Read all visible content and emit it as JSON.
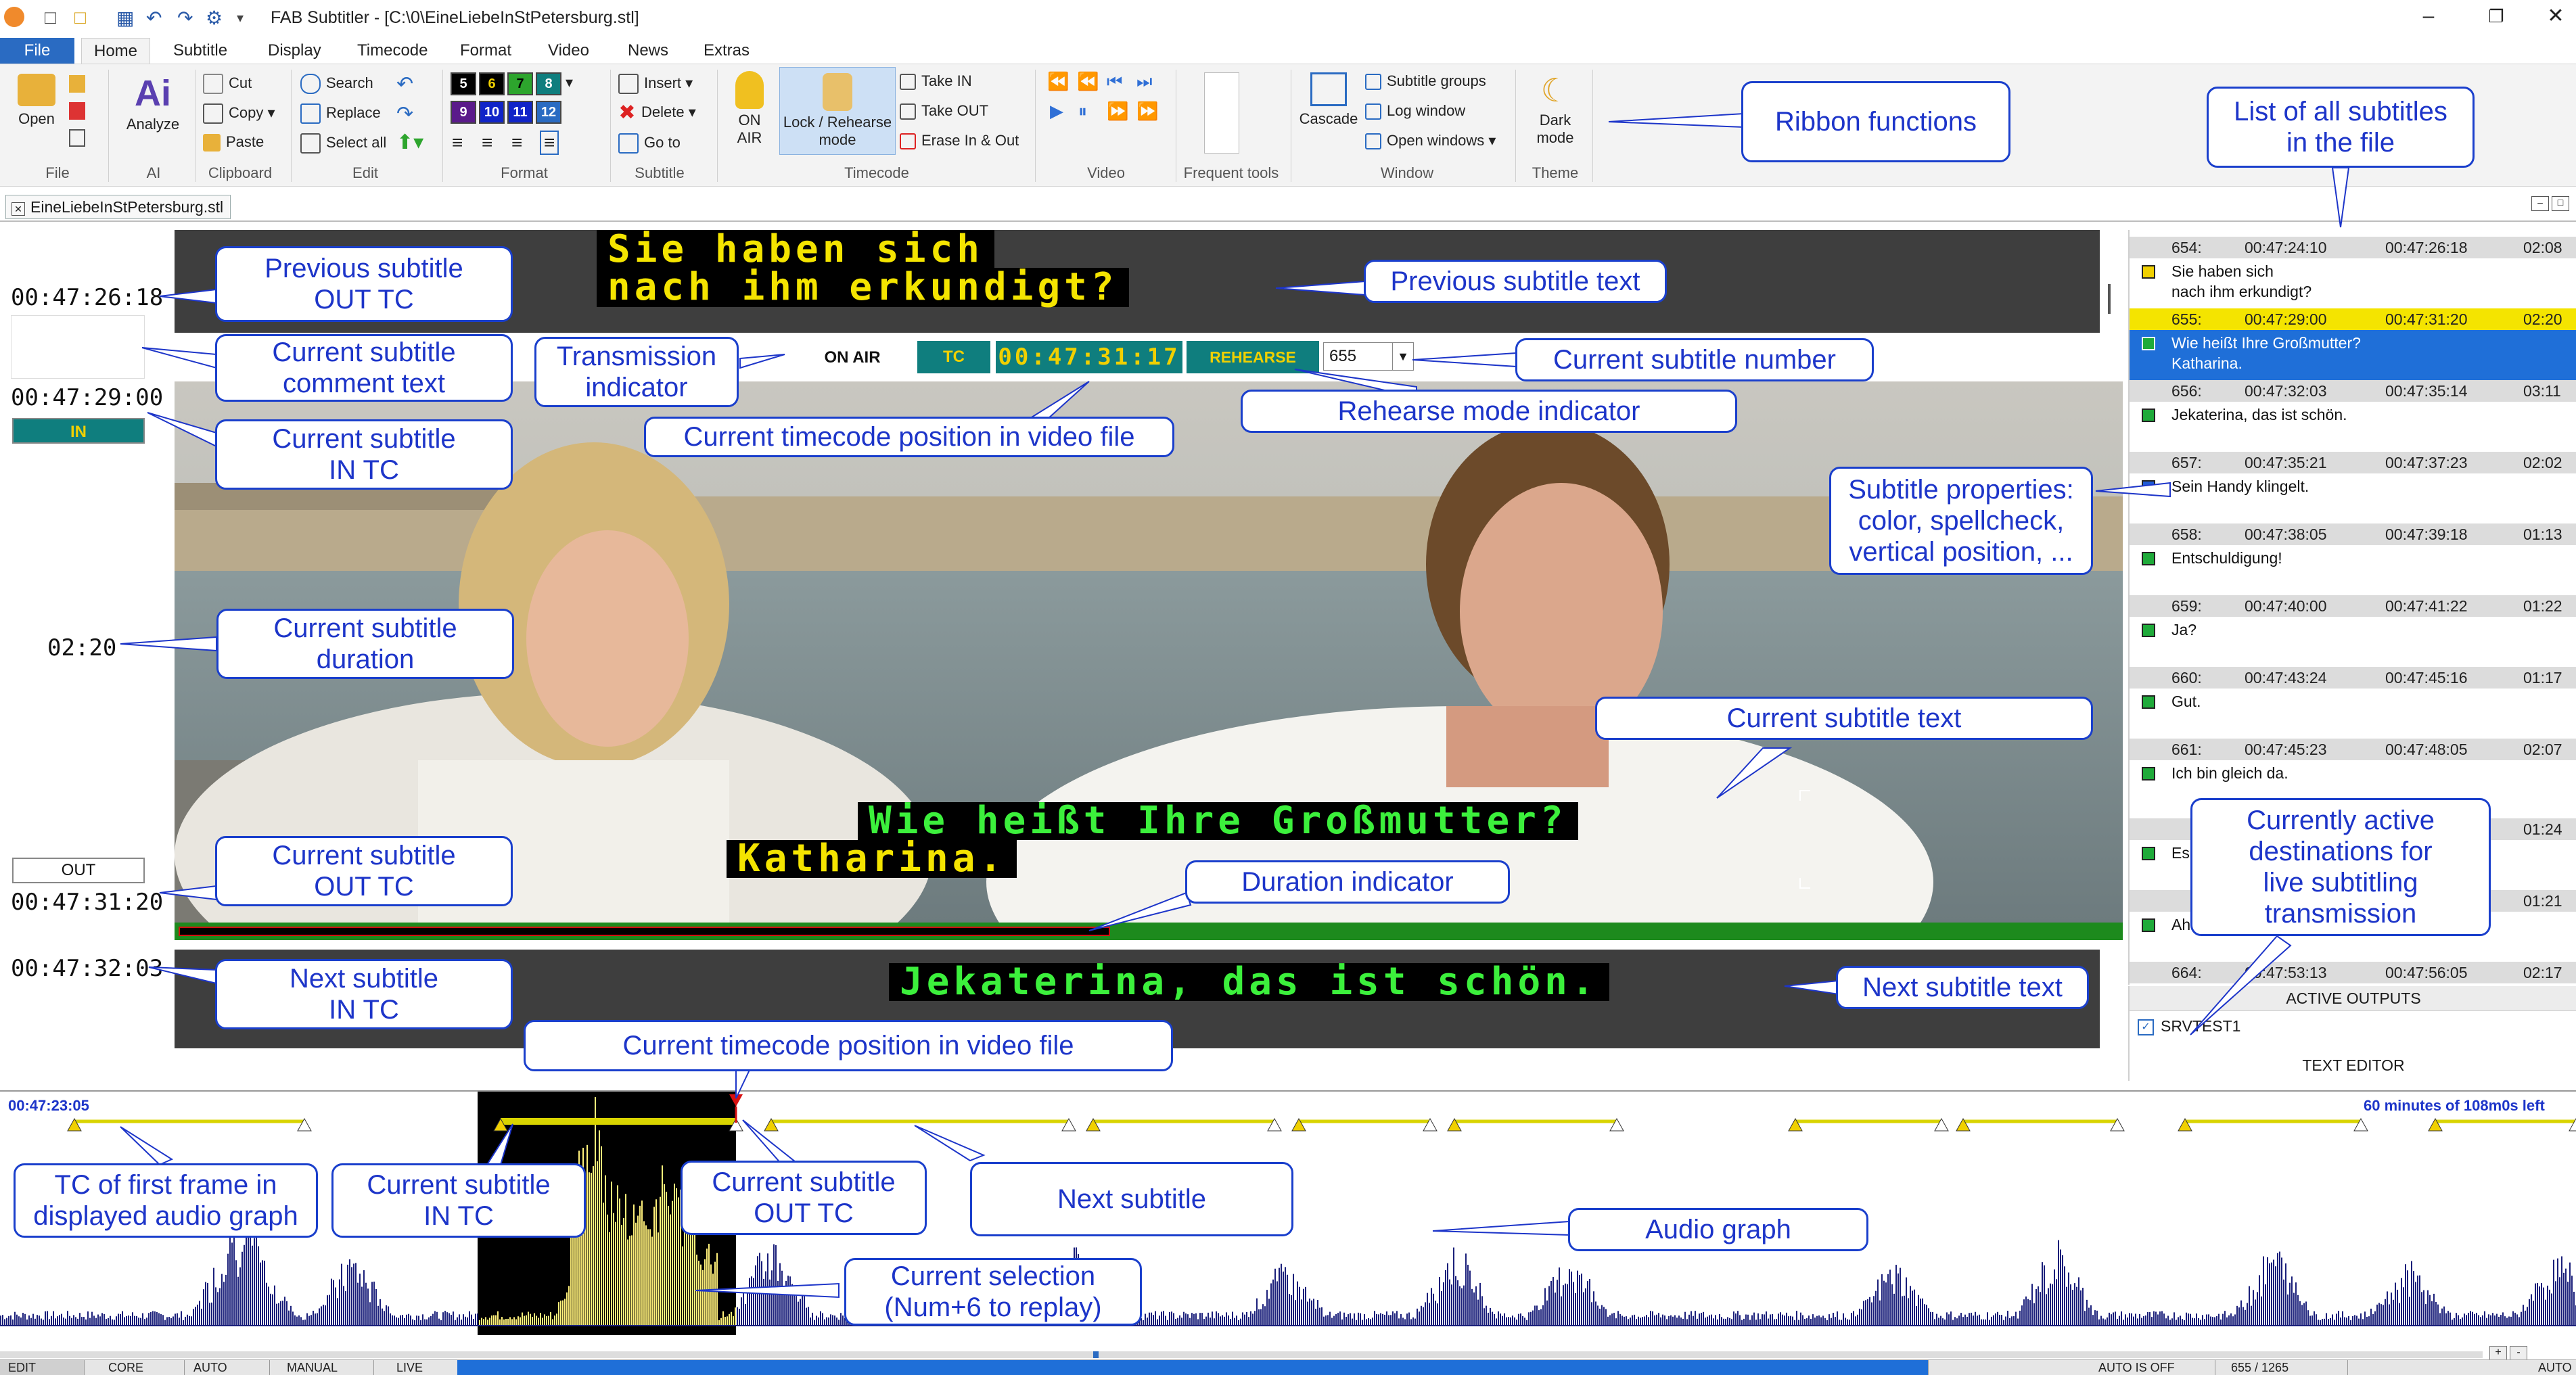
{
  "window": {
    "title": "FAB Subtitler - [C:\\0\\EineLiebeInStPetersburg.stl]",
    "doc_tab": "EineLiebeInStPetersburg.stl"
  },
  "tabs": [
    "File",
    "Home",
    "Subtitle",
    "Display",
    "Timecode",
    "Format",
    "Video",
    "News",
    "Extras"
  ],
  "ribbon": {
    "groups": {
      "file": "File",
      "ai": "AI",
      "clipboard": "Clipboard",
      "edit": "Edit",
      "format": "Format",
      "subtitle": "Subtitle",
      "timecode": "Timecode",
      "video": "Video",
      "frequent": "Frequent tools",
      "window": "Window",
      "theme": "Theme"
    },
    "open": "Open",
    "analyze": "Analyze",
    "cut": "Cut",
    "copy": "Copy",
    "paste": "Paste",
    "search": "Search",
    "replace": "Replace",
    "select_all": "Select all",
    "color_codes": [
      "5",
      "6",
      "7",
      "8",
      "9",
      "10",
      "11",
      "12"
    ],
    "insert": "Insert",
    "delete": "Delete",
    "goto": "Go to",
    "on_air_1": "ON",
    "on_air_2": "AIR",
    "lock_1": "Lock / Rehearse",
    "lock_2": "mode",
    "take_in": "Take IN",
    "take_out": "Take OUT",
    "erase": "Erase In & Out",
    "cascade": "Cascade",
    "subtitle_groups": "Subtitle groups",
    "log_window": "Log window",
    "open_windows": "Open windows",
    "dark_1": "Dark",
    "dark_2": "mode"
  },
  "editor": {
    "prev_out_tc": "00:47:26:18",
    "cur_in_tc": "00:47:29:00",
    "in_label": "IN",
    "duration": "02:20",
    "out_label": "OUT",
    "cur_out_tc": "00:47:31:20",
    "next_in_tc": "00:47:32:03",
    "prev_text_1": "Sie haben sich",
    "prev_text_2": "nach ihm erkundigt?",
    "on_air": "ON AIR",
    "tc_label": "TC",
    "tc_value": "00:47:31:17",
    "rehearse": "REHEARSE",
    "subtitle_number": "655",
    "cur_text_1": "Wie heißt Ihre Großmutter?",
    "cur_text_2": "Katharina.",
    "next_text": "Jekaterina, das ist schön.",
    "duration_progress": 0.48
  },
  "subtitle_list": [
    {
      "num": "654:",
      "in": "00:47:24:10",
      "out": "00:47:26:18",
      "dur": "02:08",
      "lines": [
        "Sie haben sich",
        "nach ihm erkundigt?"
      ],
      "dot": "#f0d000",
      "state": "normal"
    },
    {
      "num": "655:",
      "in": "00:47:29:00",
      "out": "00:47:31:20",
      "dur": "02:20",
      "lines": [
        "Wie heißt Ihre Großmutter?",
        "Katharina."
      ],
      "dot": "#1faa3a",
      "state": "current"
    },
    {
      "num": "656:",
      "in": "00:47:32:03",
      "out": "00:47:35:14",
      "dur": "03:11",
      "lines": [
        "Jekaterina, das ist schön."
      ],
      "dot": "#1faa3a",
      "state": "normal"
    },
    {
      "num": "657:",
      "in": "00:47:35:21",
      "out": "00:47:37:23",
      "dur": "02:02",
      "lines": [
        "Sein Handy klingelt."
      ],
      "dot": "#1f5bd6",
      "state": "normal"
    },
    {
      "num": "658:",
      "in": "00:47:38:05",
      "out": "00:47:39:18",
      "dur": "01:13",
      "lines": [
        "Entschuldigung!"
      ],
      "dot": "#1faa3a",
      "state": "normal"
    },
    {
      "num": "659:",
      "in": "00:47:40:00",
      "out": "00:47:41:22",
      "dur": "01:22",
      "lines": [
        "Ja?"
      ],
      "dot": "#1faa3a",
      "state": "normal"
    },
    {
      "num": "660:",
      "in": "00:47:43:24",
      "out": "00:47:45:16",
      "dur": "01:17",
      "lines": [
        "Gut."
      ],
      "dot": "#1faa3a",
      "state": "normal"
    },
    {
      "num": "661:",
      "in": "00:47:45:23",
      "out": "00:47:48:05",
      "dur": "02:07",
      "lines": [
        "Ich bin gleich da."
      ],
      "dot": "#1faa3a",
      "state": "normal"
    }
  ],
  "list_partial": {
    "row662_dur": "01:24",
    "row662_text": "Es i",
    "row663_dur": "01:21",
    "row663_text": "Aha",
    "row664_num": "664:",
    "row664_in": "00:47:53:13",
    "row664_out": "00:47:56:05",
    "row664_dur": "02:17"
  },
  "outputs": {
    "header": "ACTIVE OUTPUTS",
    "items": [
      "SRVTEST1"
    ],
    "footer": "TEXT EDITOR"
  },
  "audio": {
    "start_tc": "00:47:23:05",
    "remaining": "60 minutes of 108m0s left"
  },
  "status_bar": [
    "EDIT",
    "CORE",
    "AUTO",
    "MANUAL",
    "LIVE",
    "",
    "AUTO IS OFF",
    "655 / 1265",
    "AUTO"
  ],
  "annotations": {
    "ribbon_functions": "Ribbon functions",
    "list_all_1": "List of all subtitles",
    "list_all_2": "in the file",
    "prev_out_1": "Previous subtitle",
    "prev_out_2": "OUT TC",
    "prev_text": "Previous subtitle text",
    "comment_1": "Current subtitle",
    "comment_2": "comment text",
    "transmission_1": "Transmission",
    "transmission_2": "indicator",
    "cur_number": "Current subtitle number",
    "cur_in_1": "Current subtitle",
    "cur_in_2": "IN TC",
    "cur_tc_pos": "Current timecode position in video file",
    "rehearse_ind": "Rehearse mode indicator",
    "props_1": "Subtitle properties:",
    "props_2": "color, spellcheck,",
    "props_3": "vertical position, ...",
    "duration_1": "Current subtitle",
    "duration_2": "duration",
    "cur_text": "Current subtitle text",
    "active_dest_1": "Currently active",
    "active_dest_2": "destinations for",
    "active_dest_3": "live subtitling",
    "active_dest_4": "transmission",
    "cur_out_1": "Current subtitle",
    "cur_out_2": "OUT TC",
    "duration_ind": "Duration indicator",
    "next_in_1": "Next subtitle",
    "next_in_2": "IN TC",
    "next_text": "Next subtitle text",
    "tc_pos_audio": "Current timecode position in video file",
    "first_frame_1": "TC of first frame in",
    "first_frame_2": "displayed audio graph",
    "audio_in_1": "Current subtitle",
    "audio_in_2": "IN TC",
    "audio_out_1": "Current subtitle",
    "audio_out_2": "OUT TC",
    "next_sub": "Next subtitle",
    "audio_graph": "Audio graph",
    "selection_1": "Current selection",
    "selection_2": "(Num+6 to replay)"
  },
  "colors": {
    "accent": "#2a6bc2",
    "annotation": "#1d35c9",
    "teal": "#0f7e7e",
    "tc_yellow": "#f0d000",
    "sub_yellow": "#f4e400",
    "sub_green": "#3cf03c",
    "selection": "#1f6fd8",
    "waveform": "#1a1f7a",
    "waveform_sel": "#fff07a"
  }
}
